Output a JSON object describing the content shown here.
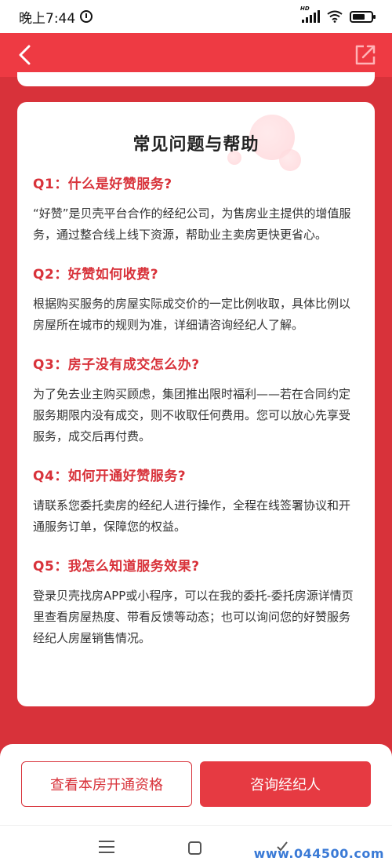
{
  "status_bar": {
    "time": "晚上7:44",
    "network_badge": "HD"
  },
  "faq": {
    "title": "常见问题与帮助",
    "items": [
      {
        "question": "Q1：什么是好赞服务?",
        "answer": "“好赞”是贝壳平台合作的经纪公司，为售房业主提供的增值服务，通过整合线上线下资源，帮助业主卖房更快更省心。"
      },
      {
        "question": "Q2：好赞如何收费?",
        "answer": "根据购买服务的房屋实际成交价的一定比例收取，具体比例以房屋所在城市的规则为准，详细请咨询经纪人了解。"
      },
      {
        "question": "Q3：房子没有成交怎么办?",
        "answer": "为了免去业主购买顾虑，集团推出限时福利——若在合同约定服务期限内没有成交，则不收取任何费用。您可以放心先享受服务，成交后再付费。"
      },
      {
        "question": "Q4：如何开通好赞服务?",
        "answer": "请联系您委托卖房的经纪人进行操作，全程在线签署协议和开通服务订单，保障您的权益。"
      },
      {
        "question": "Q5：我怎么知道服务效果?",
        "answer": "登录贝壳找房APP或小程序，可以在我的委托-委托房源详情页里查看房屋热度、带看反馈等动态；也可以询问您的好赞服务经纪人房屋销售情况。"
      }
    ]
  },
  "bottom_bar": {
    "eligibility_label": "查看本房开通资格",
    "consult_label": "咨询经纪人"
  },
  "watermark": "www.044500.com",
  "colors": {
    "brand_red": "#ee3a43",
    "question_red": "#d8323a",
    "background_red": "#d8323a"
  }
}
